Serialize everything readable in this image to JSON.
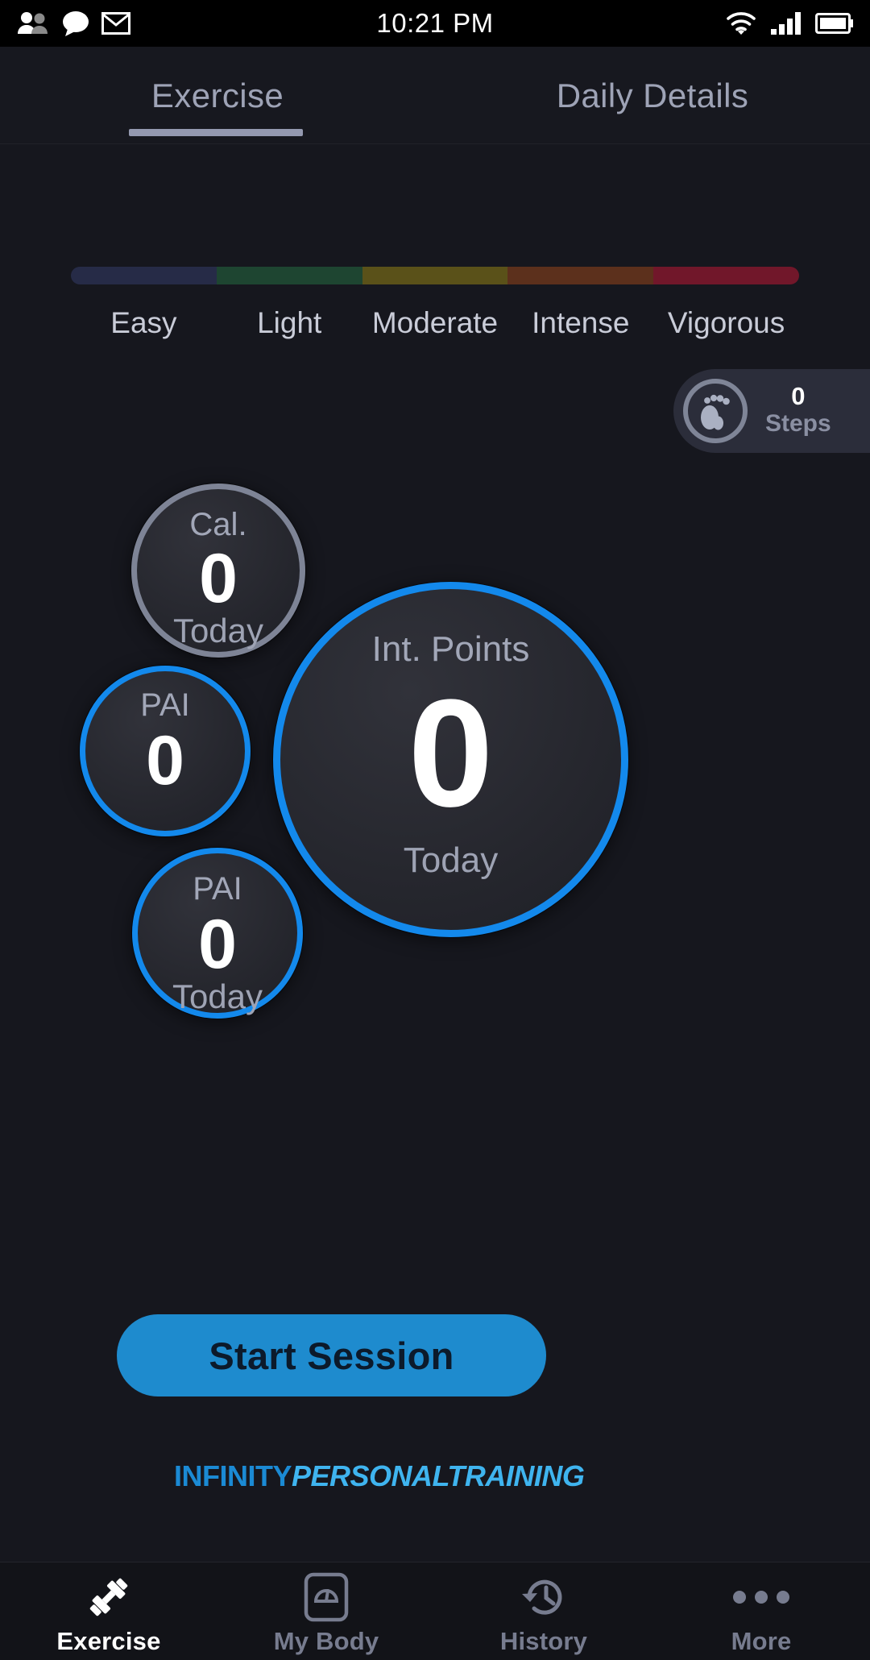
{
  "status_bar": {
    "time": "10:21 PM",
    "left_icons": [
      "contacts-icon",
      "chat-bubble-icon",
      "mail-icon"
    ],
    "right_icons": [
      "wifi-icon",
      "cellular-signal-icon",
      "battery-icon"
    ]
  },
  "tabs": {
    "items": [
      {
        "label": "Exercise",
        "active": true
      },
      {
        "label": "Daily Details",
        "active": false
      }
    ]
  },
  "intensity_scale": {
    "zones": [
      {
        "label": "Easy",
        "color": "#262b47"
      },
      {
        "label": "Light",
        "color": "#1e4531"
      },
      {
        "label": "Moderate",
        "color": "#5a5119"
      },
      {
        "label": "Intense",
        "color": "#5c301c"
      },
      {
        "label": "Vigorous",
        "color": "#71172a"
      }
    ]
  },
  "steps_widget": {
    "icon": "footprint-icon",
    "value": "0",
    "label": "Steps"
  },
  "metrics": [
    {
      "id": "cal",
      "title": "Cal.",
      "value": "0",
      "subtitle": "Today",
      "ring_color": "#7e8496"
    },
    {
      "id": "pai1",
      "title": "PAI",
      "value": "0",
      "subtitle": "",
      "ring_color": "#1389ec"
    },
    {
      "id": "pai2",
      "title": "PAI",
      "value": "0",
      "subtitle": "Today",
      "ring_color": "#1389ec"
    },
    {
      "id": "int",
      "title": "Int. Points",
      "value": "0",
      "subtitle": "Today",
      "ring_color": "#1389ec"
    }
  ],
  "action": {
    "start_label": "Start Session",
    "accent_color": "#1e8bce"
  },
  "branding": {
    "mark": "infinity-trefoil-logo",
    "name_bold": "INFINITY",
    "name_italic": "PERSONALTRAINING"
  },
  "bottom_nav": {
    "items": [
      {
        "label": "Exercise",
        "icon": "dumbbell-icon",
        "active": true
      },
      {
        "label": "My Body",
        "icon": "scale-icon",
        "active": false
      },
      {
        "label": "History",
        "icon": "clock-history-icon",
        "active": false
      },
      {
        "label": "More",
        "icon": "ellipsis-icon",
        "active": false
      }
    ]
  }
}
